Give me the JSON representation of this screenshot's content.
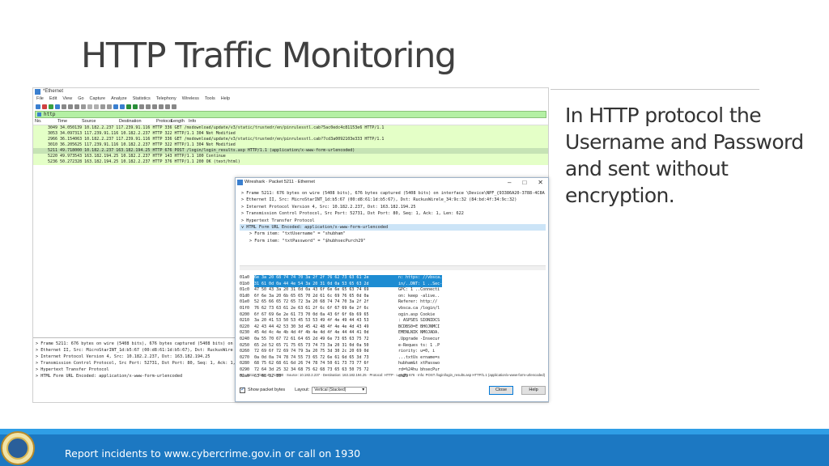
{
  "slide": {
    "title": "HTTP Traffic Monitoring",
    "body": "In HTTP protocol the Username and Password and sent without encryption.",
    "footer": "Report incidents to www.cybercrime.gov.in or call on 1930"
  },
  "wireshark_main": {
    "title": "*Ethernet",
    "menu": [
      "File",
      "Edit",
      "View",
      "Go",
      "Capture",
      "Analyze",
      "Statistics",
      "Telephony",
      "Wireless",
      "Tools",
      "Help"
    ],
    "filter_value": "http",
    "columns": [
      "No.",
      "Time",
      "Source",
      "Destination",
      "Protocol",
      "Length",
      "Info"
    ],
    "packets": [
      "3049 34.050139 10.182.2.237    117.239.91.116 HTTP    336 GET /msdownload/update/v3/static/trustedr/en/pinrulesstl.cab?5ac0edc4c81153e6 HTTP/1.1",
      "3053 34.097313 117.239.91.116 10.182.2.237    HTTP    322 HTTP/1.1 304 Not Modified",
      "2966 36.154063 10.182.2.237    117.239.91.116 HTTP    336 GET /msdownload/update/v3/static/trustedr/en/pinrulesstl.cab?7cd3a0092103e333 HTTP/1.1",
      "3010 36.205625 117.239.91.116 10.182.2.237    HTTP    322 HTTP/1.1 304 Not Modified",
      "5211 49.718000 10.182.2.237    163.182.194.25 HTTP    676 POST /login/login_results.asp HTTP/1.1  (application/x-www-form-urlencoded)",
      "5220 49.973543 163.182.194.25 10.182.2.237    HTTP    143 HTTP/1.1 100 Continue",
      "5236 50.272328 163.182.194.25 10.182.2.237    HTTP    376 HTTP/1.1 200 OK   (text/html)"
    ],
    "details": [
      "> Frame 5211: 676 bytes on wire (5408 bits), 676 bytes captured (5408 bits) on",
      "> Ethernet II, Src: MicroStarINT_1d:b5:67 (00:d8:61:1d:b5:67), Dst: RuckusWire",
      "> Internet Protocol Version 4, Src: 10.182.2.237, Dst: 163.182.194.25",
      "> Transmission Control Protocol, Src Port: 52731, Dst Port: 80, Seq: 1, Ack: 1, Len",
      "> Hypertext Transfer Protocol",
      "> HTML Form URL Encoded: application/x-www-form-urlencoded"
    ]
  },
  "packet_dialog": {
    "title": "Wireshark · Packet 5211 · Ethernet",
    "tree": [
      "> Frame 5211: 676 bytes on wire (5408 bits), 676 bytes captured (5408 bits) on interface \\Device\\NPF_{93386A20-3788-4C8A",
      "> Ethernet II, Src: MicroStarINT_1d:b5:67 (00:d8:61:1d:b5:67), Dst: RuckusWirele_34:9c:32 (84:bd:4f:34:9c:32)",
      "> Internet Protocol Version 4, Src: 10.182.2.237, Dst: 163.182.194.25",
      "> Transmission Control Protocol, Src Port: 52731, Dst Port: 80, Seq: 1, Ack: 1, Len: 622",
      "> Hypertext Transfer Protocol",
      "v HTML Form URL Encoded: application/x-www-form-urlencoded",
      "> Form item: \"txtUsername\" = \"shubham\"",
      "> Form item: \"txtPassword\" = \"$hubhsecPurch29\""
    ],
    "hex_rows": [
      {
        "off": "01a0",
        "bytes": "6e 3a 20 68 74 74 70 3a  2f 2f 76 62 73 63 61 2e",
        "ascii": "n: https: //vbsca."
      },
      {
        "off": "01b0",
        "bytes": "31 61 0d 0a 44 4e 54 3a  20 31 0d 0a 53 65 63 2d",
        "ascii": "in/..DNT: 1 ..Sec-"
      },
      {
        "off": "01c0",
        "bytes": "47 50 43 3a 20 31 0d 0a  43 6f 6e 6e 65 63 74 69",
        "ascii": "GPC: 1 ..Connecti"
      },
      {
        "off": "01d0",
        "bytes": "6f 6e 3a 20 6b 65 65 70  2d 61 6c 69 76 65 0d 0a",
        "ascii": "on: keep -alive.."
      },
      {
        "off": "01e0",
        "bytes": "52 65 66 65 72 65 72 3a  20 68 74 74 70 3a 2f 2f",
        "ascii": "Referer:  http://"
      },
      {
        "off": "01f0",
        "bytes": "76 62 73 63 61 2e 63 61  2f 6c 6f 67 69 6e 2f 6c",
        "ascii": "vbsca.ca /login/l"
      },
      {
        "off": "0200",
        "bytes": "6f 67 69 6e 2e 61 73 70  0d 0a 43 6f 6f 6b 69 65",
        "ascii": "ogin.asp  Cookie"
      },
      {
        "off": "0210",
        "bytes": "3a 20 41 53 50 53 45 53  53 49 4f 4e 49 44 43 53",
        "ascii": ": ASPSES SIONIDCS"
      },
      {
        "off": "0220",
        "bytes": "42 43 44 42 53 30 3d 45  42 48 4f 4e 4e 4d 43 49",
        "ascii": "BCDBS0=E BHOJNMCI"
      },
      {
        "off": "0230",
        "bytes": "45 4d 4c 4e 4b 4d 4f 4b  4e 4d 4f 4e 44 44 41 0d",
        "ascii": "EMENLNIK NMOJADA."
      },
      {
        "off": "0240",
        "bytes": "0a 55 70 67 72 61 64 65  2d 49 6e 73 65 63 75 72",
        "ascii": ".Upgrade -Insecur"
      },
      {
        "off": "0250",
        "bytes": "65 2d 52 65 71 75 65 73  74 73 3a 20 31 0d 0a 50",
        "ascii": "e-Reques ts: 1 .P"
      },
      {
        "off": "0260",
        "bytes": "72 69 6f 72 69 74 79 3a  20 75 3d 30 2c 20 69 0d",
        "ascii": "riority:  u=0, i"
      },
      {
        "off": "0270",
        "bytes": "0a 0d 0a 74 78 74 55 73  65 72 6e 61 6d 65 3d 73",
        "ascii": "...txtUs ername=s"
      },
      {
        "off": "0280",
        "bytes": "68 75 62 68 61 6d 26 74  78 74 50 61 73 73 77 6f",
        "ascii": "hubham&t xtPasswo"
      },
      {
        "off": "0290",
        "bytes": "72 64 3d 25 32 34 68 75  62 68 73 65 63 50 75 72",
        "ascii": "rd=%24hu bhsecPur"
      },
      {
        "off": "02a0",
        "bytes": "63 68 32 39",
        "ascii": "ch29"
      }
    ],
    "status": "No.: 5211 · Time: 49.718000 · Source: 10.182.2.237 · Destination: 163.182.194.25 · Protocol: HTTP · Length: 676 · Info: POST /login/login_results.asp HTTP/1.1  (application/x-www-form-urlencoded)",
    "show_packet_bytes_label": "Show packet bytes",
    "show_packet_bytes_checked": true,
    "layout_label": "Layout:",
    "layout_value": "Vertical (Stacked)",
    "close_label": "Close",
    "help_label": "Help"
  },
  "colors": {
    "packet_row": "#e4ffc7",
    "filter_bg": "#b4f0a4",
    "hex_selection": "#1e8cd2",
    "footer_band": "#1c78c2"
  }
}
